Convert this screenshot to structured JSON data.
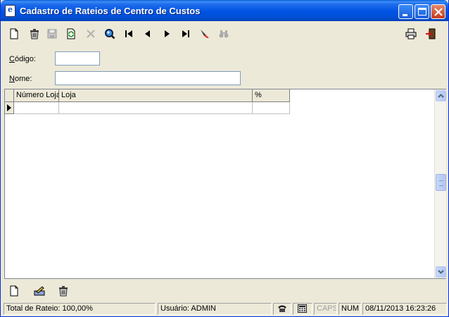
{
  "window": {
    "title": "Cadastro de Rateios de Centro de Custos",
    "icon_name": "app-document-icon",
    "controls": {
      "minimize": "minimize-icon",
      "maximize": "maximize-icon",
      "close": "close-icon"
    }
  },
  "toolbar": {
    "items": [
      "new-document-icon",
      "delete-trash-icon",
      "save-disk-icon",
      "refresh-icon",
      "cancel-x-icon",
      "search-magnifier-icon",
      "first-record-icon",
      "previous-record-icon",
      "next-record-icon",
      "last-record-icon",
      "filter-icon",
      "find-binoculars-icon"
    ],
    "right_items": [
      "print-icon",
      "exit-door-icon"
    ]
  },
  "form": {
    "codigo": {
      "label_underline": "C",
      "label_rest": "ódigo:",
      "value": ""
    },
    "nome": {
      "label_underline": "N",
      "label_rest": "ome:",
      "value": ""
    }
  },
  "grid": {
    "columns": [
      "Número Loja",
      "Loja",
      "%"
    ],
    "rows": [
      [
        "",
        "",
        ""
      ]
    ]
  },
  "bottom_toolbar": [
    "add-row-icon",
    "edit-row-icon",
    "delete-row-icon"
  ],
  "status": {
    "total": "Total de Rateio: 100,00%",
    "user": "Usuário: ADMIN",
    "phone_icon": "phone-icon",
    "calc_icon": "calculator-icon",
    "caps": "CAPS",
    "num": "NUM",
    "datetime": "08/11/2013 16:23:26"
  },
  "colors": {
    "titlebar": "#0053e1",
    "window_bg": "#ece9d8",
    "field_border": "#7f9db9"
  }
}
